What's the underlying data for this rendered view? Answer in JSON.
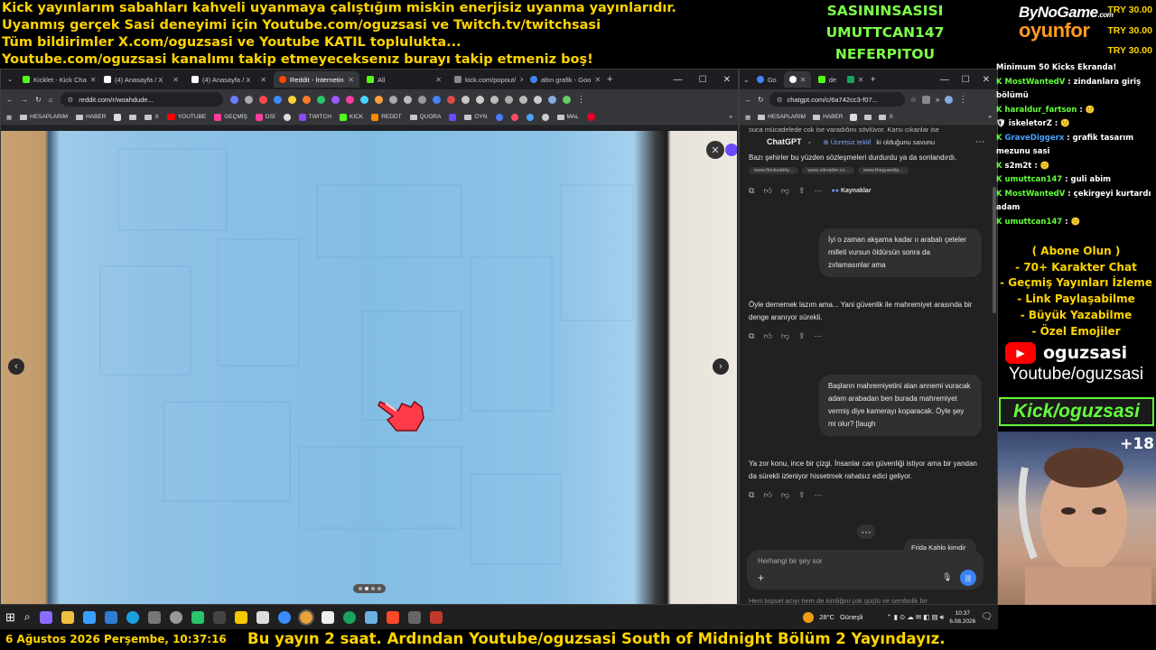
{
  "overlay": {
    "lines": [
      "Kick yayınlarım sabahları kahveli uyanmaya çalıştığım miskin enerjisiz uyanma yayınlarıdır.",
      "Uyanmış gerçek Sasi deneyimi için Youtube.com/oguzsasi ve Twitch.tv/twitchsasi",
      "Tüm bildirimler X.com/oguzsasi ve Youtube KATIL toplulukta...",
      "Youtube.com/oguzsasi kanalımı takip etmeyeceksenız burayı takip etmeniz boş!"
    ],
    "names": [
      "SASININSASISI",
      "UMUTTCAN147",
      "NEFERPITOU"
    ],
    "brand_top": "ByNoGame",
    "brand_com": ".com",
    "brand_bottom": "oyunfor",
    "donations": [
      "TRY 30.00",
      "TRY 30.00",
      "TRY 30.00"
    ]
  },
  "left_browser": {
    "tabs": [
      {
        "label": "Kicklet - Kick Cha",
        "color": "#53fc18"
      },
      {
        "label": "(4) Anasayfa / X",
        "color": "#ffffff"
      },
      {
        "label": "(4) Anasayfa / X",
        "color": "#ffffff"
      },
      {
        "label": "Reddit - İnternetin",
        "color": "#ff4500",
        "active": true
      },
      {
        "label": "All",
        "color": "#53fc18"
      },
      {
        "label": "kick.com/popout/",
        "color": "#888888"
      },
      {
        "label": "altın grafik - Goo",
        "color": "#4285f4"
      }
    ],
    "url": "reddit.com/r/woahdude...",
    "bookmarks": [
      "HESAPLARIM",
      "HABER",
      "",
      "",
      "X",
      "YOUTUBE",
      "GEÇMİŞ",
      "DSİ",
      "",
      "TWITCH",
      "KICK",
      "REDDT",
      "QUORA",
      "",
      "OYN",
      "",
      "",
      "",
      "",
      "MAL",
      ""
    ]
  },
  "right_browser": {
    "tabs": [
      {
        "label": "Go",
        "color": "#4285f4"
      },
      {
        "label": "",
        "color": "#ffffff",
        "active": true
      },
      {
        "label": "de",
        "color": "#53fc18"
      },
      {
        "label": "",
        "color": "#1aa260"
      }
    ],
    "url": "chatgpt.com/c/6a742cc3-f07...",
    "bookmarks": [
      "HESAPLARIM",
      "HABER",
      "",
      "",
      "X"
    ]
  },
  "chatgpt": {
    "header": "ChatGPT",
    "offer": "Ücretsiz teklif",
    "header_tail": "ki olduğunu savunu",
    "top_partial": "suça mücadelede çok işe yaradığını söylüyor. Karşı çıkanlar ise",
    "top_text": "Bazı şehirler bu yüzden sözleşmeleri durdurdu ya da sonlandırdı.",
    "chips": [
      "www.flocksafety...",
      "www.zdnsider.co...",
      "www.theguardia..."
    ],
    "sources_label": "Kaynaklar",
    "user_msg_1": "İyi o zaman akşama kadar ıı arabalı çeteler milleti vursun öldürsün sonra da zırlamasınlar ama",
    "reply_1": "Öyle dememek lazım ama... Yani güvenlik ile mahremiyet arasında bir denge aranıyor sürekli.",
    "user_msg_2": "Başların mahremiyetini alan annemi vuracak adam arabadan ben burada mahremiyet vermiş diye kamerayı koparacak. Öyle şey mi olur? [laugh",
    "reply_2": "Ya zor konu, ince bir çizgi. İnsanlar can güvenliği istiyor ama bir yandan da sürekli izleniyor hissetmek rahatsız edici geliyor.",
    "partial_bubble": "Frida Kahlo kimdir",
    "input_placeholder": "Herhangi bir şey sor",
    "footer_partial": "Hem kişisel acıyı hem de kimliğini çok güçlü ve sembolik bir"
  },
  "chat": {
    "header": "Minimum 50 Kicks Ekranda!",
    "messages": [
      {
        "user": "MostWantedV",
        "text": "zindanlara giriş bölümü",
        "color": "#63ff3b"
      },
      {
        "user": "haraldur_fartson",
        "text": "🙂",
        "color": "#63ff3b"
      },
      {
        "user": "iskeletorZ",
        "text": "🙂",
        "color": "#ffffff"
      },
      {
        "user": "GraveDiggerx",
        "text": "grafik tasarım mezunu sasi",
        "color": "#4aa3ff"
      },
      {
        "user": "s2m2t",
        "text": "🙂",
        "color": "#ffffff"
      },
      {
        "user": "umuttcan147",
        "text": "guli abim",
        "color": "#63ff3b"
      },
      {
        "user": "MostWantedV",
        "text": "çekirgeyi kurtardı adam",
        "color": "#63ff3b"
      },
      {
        "user": "umuttcan147",
        "text": "🙂",
        "color": "#63ff3b"
      }
    ]
  },
  "promo": {
    "lines": [
      "( Abone Olun )",
      "- 70+ Karakter Chat",
      "- Geçmiş Yayınları İzleme",
      "- Link Paylaşabilme",
      "- Büyük Yazabilme",
      "- Özel Emojiler"
    ],
    "yt_name": "oguzsasi",
    "yt_url": "Youtube/oguzsasi",
    "kick_url": "Kick/oguzsasi",
    "cam_badge": "+18"
  },
  "taskbar": {
    "weather": "28°C",
    "weather_desc": "Güneşli",
    "time": "10:37",
    "date": "6.08.2026"
  },
  "bottom": {
    "datetime": "6 Ağustos 2026 Perşembe, 10:37:16",
    "ticker": "Bu yayın 2 saat. Ardından Youtube/oguzsasi South of Midnight Bölüm 2 Yayındayız."
  },
  "colors": {
    "overlay_yellow": "#ffd400",
    "kick_green": "#63ff3b",
    "youtube_red": "#ff0000"
  }
}
